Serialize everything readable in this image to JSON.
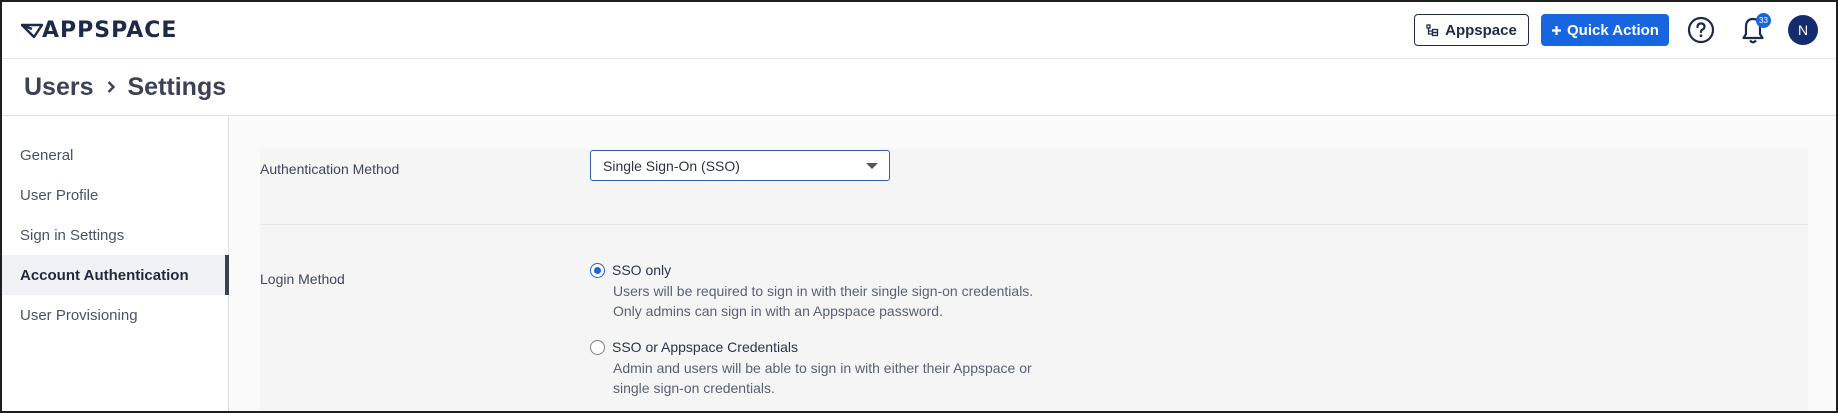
{
  "header": {
    "logo_text": "APPSPACE",
    "appspace_button_label": "Appspace",
    "quick_action_label": "Quick Action",
    "notification_count": "33",
    "avatar_initial": "N",
    "accent_color": "#1766e0",
    "brand_navy": "#1d2a4a"
  },
  "breadcrumb": {
    "items": [
      "Users",
      "Settings"
    ]
  },
  "sidebar": {
    "items": [
      {
        "label": "General",
        "active": false
      },
      {
        "label": "User Profile",
        "active": false
      },
      {
        "label": "Sign in Settings",
        "active": false
      },
      {
        "label": "Account Authentication",
        "active": true
      },
      {
        "label": "User Provisioning",
        "active": false
      }
    ]
  },
  "main": {
    "auth_method": {
      "label": "Authentication Method",
      "selected_value": "Single Sign-On (SSO)"
    },
    "login_method": {
      "label": "Login Method",
      "options": [
        {
          "title": "SSO only",
          "checked": true,
          "description_lines": [
            "Users will be required to sign in with their single sign-on credentials.",
            "Only admins can sign in with an Appspace password."
          ]
        },
        {
          "title": "SSO or Appspace Credentials",
          "checked": false,
          "description_lines": [
            "Admin and users will be able to sign in with either their Appspace or",
            "single sign-on credentials."
          ]
        }
      ]
    }
  }
}
